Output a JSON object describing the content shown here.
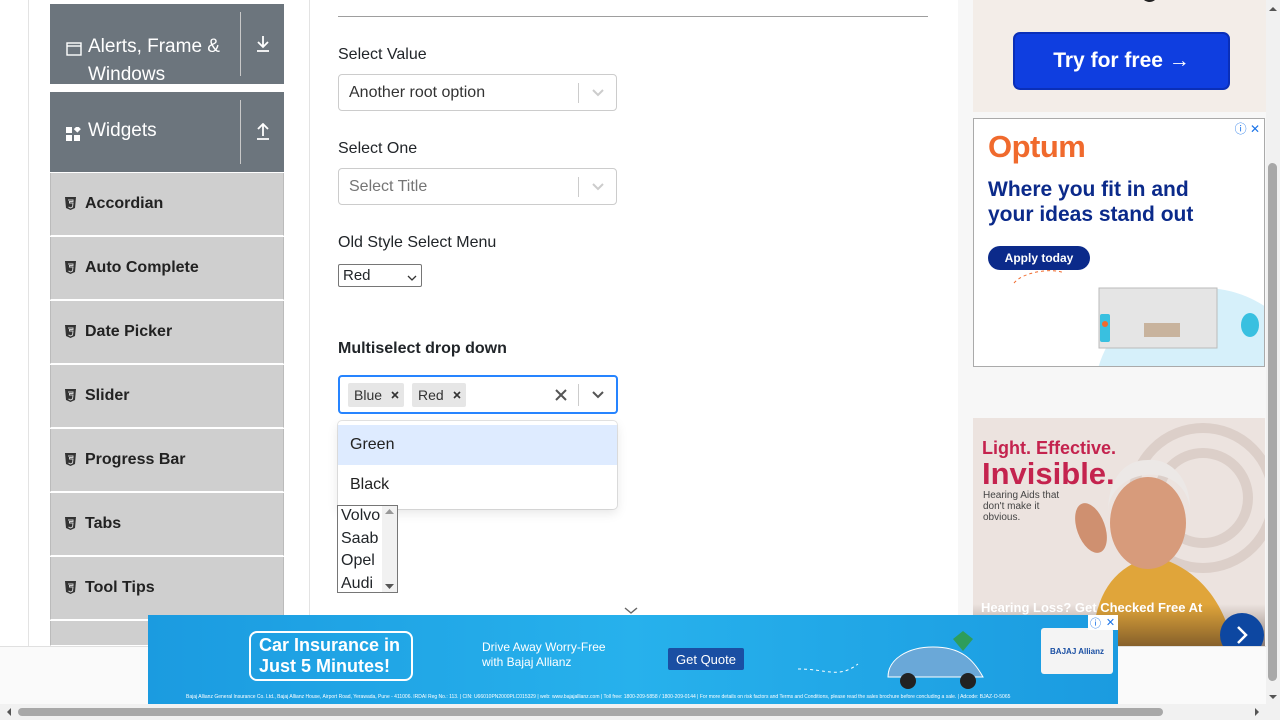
{
  "sidebar": {
    "groups": [
      {
        "label": "Alerts, Frame & Windows",
        "icon": "window-icon",
        "toggle_icon": "download-arrow-icon"
      },
      {
        "label": "Widgets",
        "icon": "widgets-grid-icon",
        "toggle_icon": "upload-arrow-icon"
      }
    ],
    "items": [
      {
        "label": "Accordian",
        "icon": "html5-icon"
      },
      {
        "label": "Auto Complete",
        "icon": "html5-icon"
      },
      {
        "label": "Date Picker",
        "icon": "html5-icon"
      },
      {
        "label": "Slider",
        "icon": "html5-icon"
      },
      {
        "label": "Progress Bar",
        "icon": "html5-icon"
      },
      {
        "label": "Tabs",
        "icon": "html5-icon"
      },
      {
        "label": "Tool Tips",
        "icon": "html5-icon"
      }
    ]
  },
  "main": {
    "select_value": {
      "label": "Select Value",
      "value": "Another root option"
    },
    "select_one": {
      "label": "Select One",
      "placeholder": "Select Title"
    },
    "old_style": {
      "label": "Old Style Select Menu",
      "value": "Red"
    },
    "multiselect": {
      "label": "Multiselect drop down",
      "chips": [
        "Blue",
        "Red"
      ],
      "options": [
        "Green",
        "Black"
      ],
      "focused_option": "Green"
    },
    "cars_list": [
      "Volvo",
      "Saab",
      "Opel",
      "Audi"
    ]
  },
  "ads": {
    "top_button": "Try for free →",
    "optum": {
      "brand": "Optum",
      "headline": "Where you fit in and your ideas stand out",
      "cta": "Apply today"
    },
    "hearing": {
      "line1": "Light. Effective.",
      "line2": "Invisible.",
      "line3": "Hearing Aids that don't make it obvious.",
      "footer": "Hearing Loss? Get Checked Free At"
    },
    "banner": {
      "headline": "Car Insurance in Just 5 Minutes!",
      "tagline": "Drive Away Worry-Free with Bajaj Allianz",
      "cta": "Get Quote",
      "logo": "BAJAJ Allianz",
      "fineprint": "Bajaj Allianz General Insurance Co. Ltd., Bajaj Allianz House, Airport Road, Yerawada, Pune - 411006. IRDAI Reg No.: 113. | CIN: U66010PN2000PLC015329 | web: www.bajajallianz.com | Toll free: 1800-209-5858 / 1800-209-0144 | For more details on risk factors and Terms and Conditions, please read the sales brochure before concluding a sale. | Adcode: BJAZ-O-5065"
    }
  },
  "colors": {
    "group_bg": "#6c757d",
    "item_bg": "#cfcfcf",
    "focus_blue": "#2684ff",
    "option_focus": "#deebff"
  }
}
